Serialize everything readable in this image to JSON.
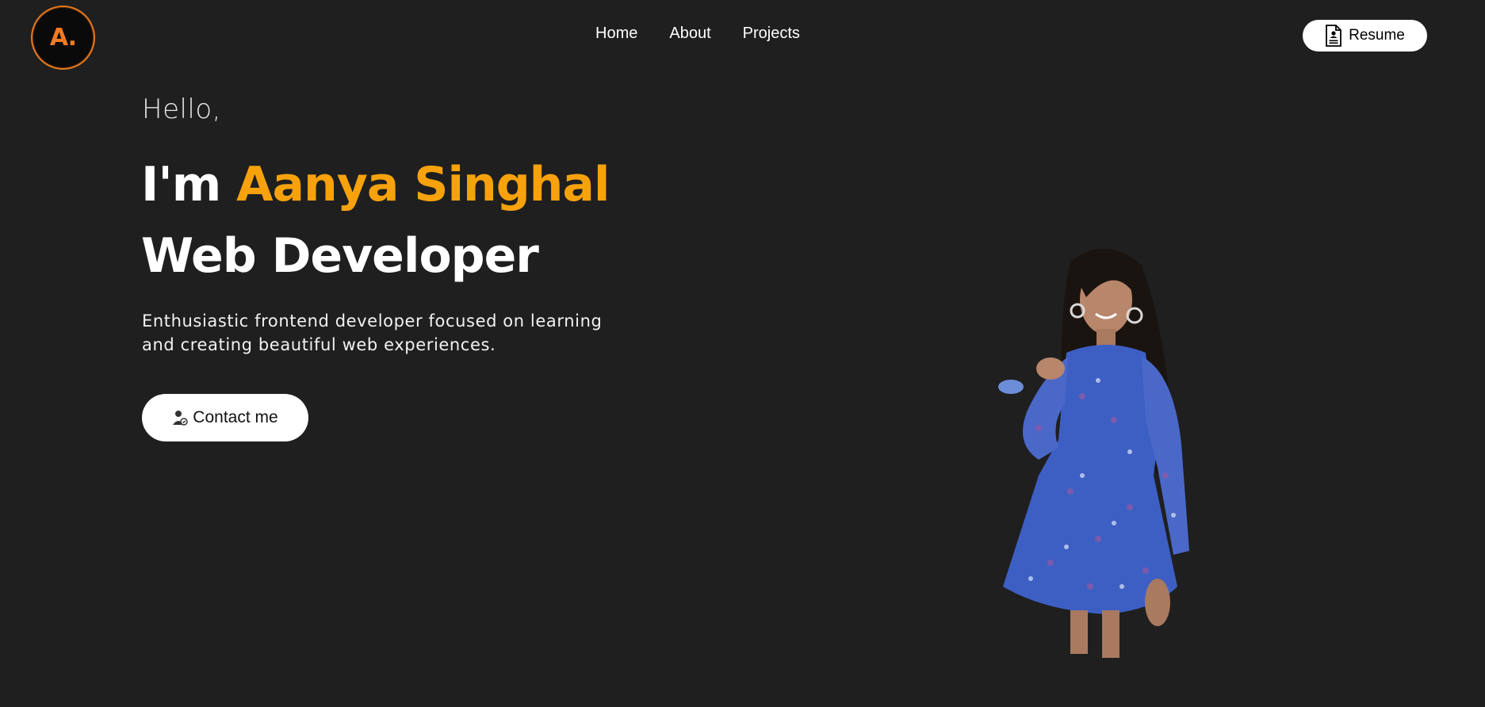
{
  "header": {
    "logo_text": "A.",
    "nav": [
      "Home",
      "About",
      "Projects"
    ],
    "resume_label": "Resume"
  },
  "hero": {
    "greeting": "Hello,",
    "intro_prefix": "I'm",
    "name": "Aanya Singhal",
    "role": "Web Developer",
    "description": "Enthusiastic frontend developer focused on learning and creating beautiful web experiences.",
    "contact_label": "Contact me"
  },
  "icons": {
    "resume": "document-person-icon",
    "contact": "person-contact-icon"
  },
  "colors": {
    "background": "#1f1f1f",
    "accent": "#f7a20d",
    "logo_ring": "#e4781f"
  }
}
